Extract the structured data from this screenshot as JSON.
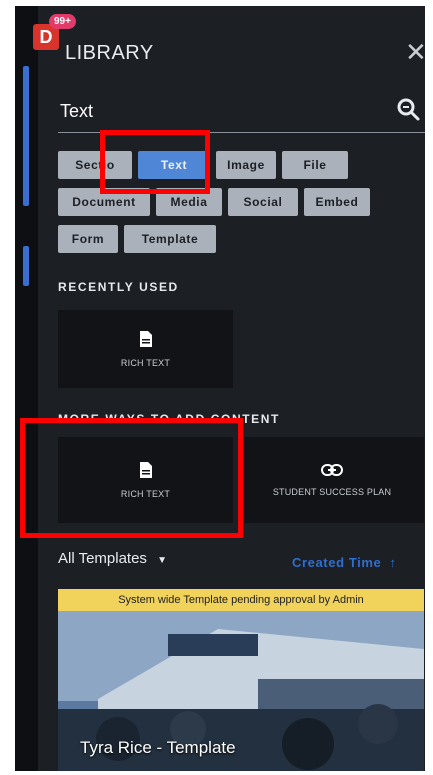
{
  "app": {
    "badge_letter": "D",
    "notification_count": "99+"
  },
  "header": {
    "title": "LIBRARY",
    "close_icon": "close-icon"
  },
  "search": {
    "value": "Text",
    "icon": "search-icon"
  },
  "filters": [
    {
      "label": "Sectio",
      "active": false
    },
    {
      "label": "Text",
      "active": true
    },
    {
      "label": "Image",
      "active": false
    },
    {
      "label": "File",
      "active": false
    },
    {
      "label": "Document",
      "active": false
    },
    {
      "label": "Media",
      "active": false
    },
    {
      "label": "Social",
      "active": false
    },
    {
      "label": "Embed",
      "active": false
    },
    {
      "label": "Form",
      "active": false
    },
    {
      "label": "Template",
      "active": false
    }
  ],
  "recently_used": {
    "heading": "RECENTLY USED",
    "items": [
      {
        "label": "RICH TEXT",
        "icon": "document-icon"
      }
    ]
  },
  "more_ways": {
    "heading": "MORE WAYS TO ADD CONTENT",
    "items": [
      {
        "label": "RICH TEXT",
        "icon": "document-icon"
      },
      {
        "label": "STUDENT SUCCESS PLAN",
        "icon": "link-icon"
      }
    ]
  },
  "templates": {
    "heading": "All Templates",
    "sort_label": "Created Time",
    "card": {
      "banner": "System wide Template pending approval by Admin",
      "name": "Tyra Rice - Template"
    }
  },
  "colors": {
    "panel": "#1c1f24",
    "accent": "#4f86d6",
    "highlight": "#ff0000",
    "banner": "#f1d35b"
  }
}
